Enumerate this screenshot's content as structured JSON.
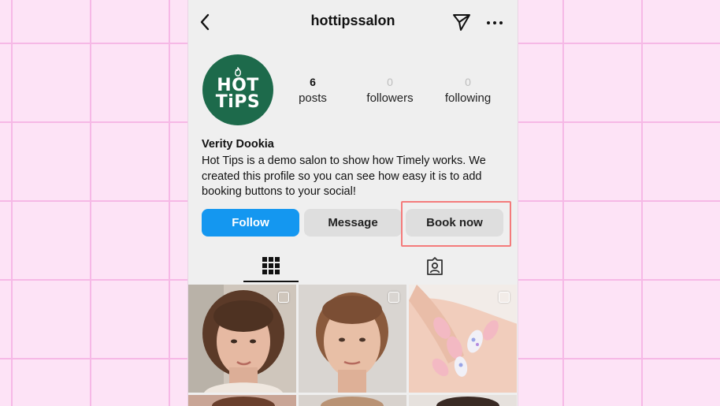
{
  "header": {
    "handle": "hottipssalon",
    "back_icon": "chevron-left-icon",
    "send_icon": "paper-plane-icon",
    "more_icon": "more-horizontal-icon"
  },
  "profile": {
    "logo_text": [
      "HOT",
      "TiPS"
    ],
    "stats": [
      {
        "value": "6",
        "label": "posts"
      },
      {
        "value": "0",
        "label": "followers"
      },
      {
        "value": "0",
        "label": "following"
      }
    ],
    "name": "Verity Dookia",
    "bio": "Hot Tips is a demo salon to show how Timely works. We created this profile so you can see how easy it is to add booking buttons to your social!"
  },
  "actions": {
    "follow": "Follow",
    "message": "Message",
    "book": "Book now"
  },
  "tabs": [
    {
      "icon": "grid-icon",
      "active": true
    },
    {
      "icon": "tagged-icon",
      "active": false
    }
  ],
  "posts": [
    {
      "subject": "woman with curly brown hair"
    },
    {
      "subject": "woman with hair pulled back"
    },
    {
      "subject": "manicured almond nails with floral art"
    }
  ],
  "colors": {
    "background": "#fde3f6",
    "grid_lines": "#f6b8e6",
    "follow_button": "#1497f0",
    "logo_green": "#1d6a4b",
    "highlight_box": "#f47b7b"
  }
}
